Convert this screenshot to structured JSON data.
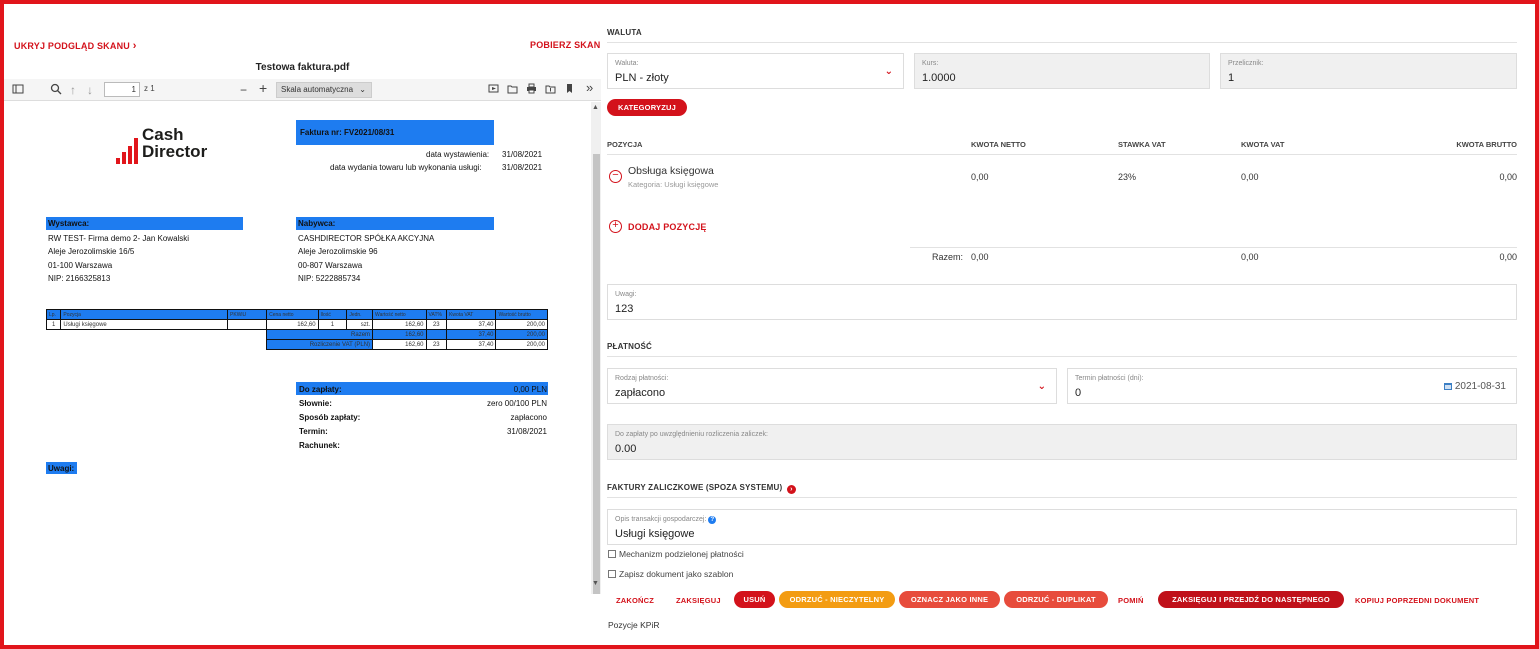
{
  "viewer": {
    "hide_scan": "UKRYJ PODGLĄD SKANU",
    "hide_chevron": "›",
    "download_scan": "POBIERZ SKAN",
    "file_name": "Testowa faktura.pdf",
    "page_number": "1",
    "page_of": "z 1",
    "zoom": "Skala automatyczna",
    "more": "»"
  },
  "invoice": {
    "logo_line1": "Cash",
    "logo_line2": "Director",
    "number": "Faktura nr: FV2021/08/31",
    "issue_label": "data wystawienia:",
    "issue_date": "31/08/2021",
    "delivery_label": "data wydania towaru lub wykonania usługi:",
    "delivery_date": "31/08/2021",
    "seller_label": "Wystawca:",
    "seller": [
      "RW TEST- Firma demo 2- Jan Kowalski",
      "Aleje Jerozolimskie 16/5",
      "01-100 Warszawa",
      "NIP: 2166325813"
    ],
    "buyer_label": "Nabywca:",
    "buyer": [
      "CASHDIRECTOR SPÓŁKA AKCYJNA",
      "Aleje Jerozolimskie 96",
      "00-807 Warszawa",
      "NIP: 5222885734"
    ],
    "table_headers": [
      "Lp.",
      "Pozycja",
      "PKWiU",
      "Cena netto",
      "Ilość",
      "Jedn.",
      "Wartość netto",
      "VAT%",
      "Kwota VAT",
      "Wartość brutto"
    ],
    "table_row": [
      "1",
      "Usługi księgowe",
      "",
      "162,60",
      "1",
      "szt.",
      "162,60",
      "23",
      "37,40",
      "200,00"
    ],
    "razem_label": "Razem",
    "razem_row": [
      "162,60",
      "23",
      "37,40",
      "200,00"
    ],
    "rozliczenie_label": "Rozliczenie VAT (PLN)",
    "rozliczenie_row": [
      "162,60",
      "23",
      "37,40",
      "200,00"
    ],
    "to_pay_label": "Do zapłaty:",
    "to_pay": "0,00 PLN",
    "words_label": "Słownie:",
    "words": "zero 00/100 PLN",
    "method_label": "Sposób zapłaty:",
    "method": "zapłacono",
    "due_label": "Termin:",
    "due": "31/08/2021",
    "account_label": "Rachunek:",
    "notes_label": "Uwagi:"
  },
  "form": {
    "currency_section": "WALUTA",
    "currency_label": "Waluta:",
    "currency_value": "PLN - złoty",
    "rate_label": "Kurs:",
    "rate_value": "1.0000",
    "converter_label": "Przelicznik:",
    "converter_value": "1",
    "categorize": "KATEGORYZUJ",
    "col_position": "POZYCJA",
    "col_net": "KWOTA NETTO",
    "col_vat_rate": "STAWKA VAT",
    "col_vat": "KWOTA VAT",
    "col_gross": "KWOTA BRUTTO",
    "item_name": "Obsługa księgowa",
    "item_category": "Kategoria: Usługi księgowe",
    "item_net": "0,00",
    "item_rate": "23%",
    "item_vat": "0,00",
    "item_gross": "0,00",
    "add_position": "DODAJ POZYCJĘ",
    "total_label": "Razem:",
    "total_net": "0,00",
    "total_vat": "0,00",
    "total_gross": "0,00",
    "notes_label": "Uwagi:",
    "notes_value": "123",
    "payment_section": "PŁATNOŚĆ",
    "payment_type_label": "Rodzaj płatności:",
    "payment_type_value": "zapłacono",
    "payment_term_label": "Termin płatności (dni):",
    "payment_term_value": "0",
    "payment_date": "2021-08-31",
    "topay_label": "Do zapłaty po uwzględnieniu rozliczenia zaliczek:",
    "topay_value": "0.00",
    "advance_section": "FAKTURY ZALICZKOWE (SPOZA SYSTEMU)",
    "desc_label": "Opis transakcji gospodarczej:",
    "desc_value": "Usługi księgowe",
    "split_payment": "Mechanizm podzielonej płatności",
    "save_template": "Zapisz dokument jako szablon",
    "kpir": "Pozycje KPiR"
  },
  "actions": {
    "finish": "ZAKOŃCZ",
    "post": "ZAKSIĘGUJ",
    "delete": "USUŃ",
    "reject_illegible": "ODRZUĆ - NIECZYTELNY",
    "mark_other": "OZNACZ JAKO INNE",
    "reject_duplicate": "ODRZUĆ - DUPLIKAT",
    "skip": "POMIŃ",
    "post_next": "ZAKSIĘGUJ I PRZEJDŹ DO NASTĘPNEGO",
    "copy_prev": "KOPIUJ POPRZEDNI DOKUMENT"
  },
  "colors": {
    "brand_red": "#d3121b",
    "orange": "#f39c12",
    "pdf_blue": "#1e7cf0",
    "frame": "#e1151b"
  }
}
